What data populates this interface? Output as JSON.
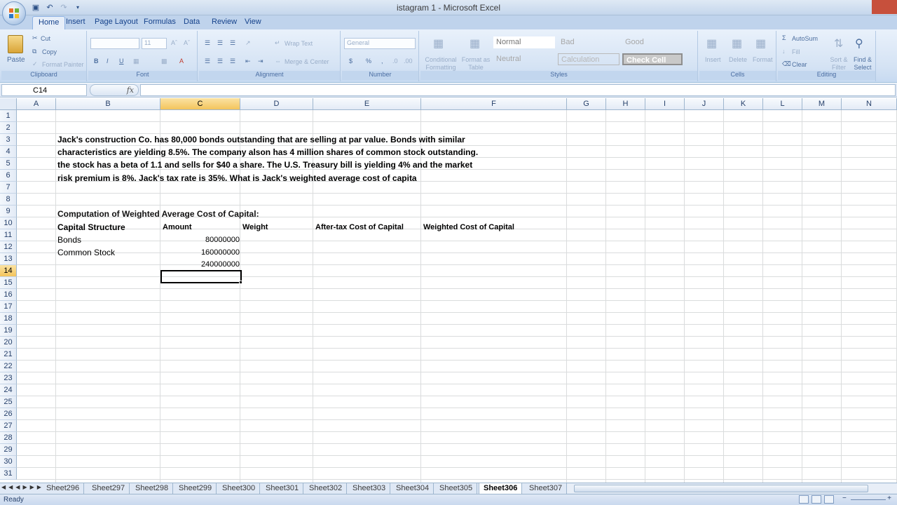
{
  "window": {
    "title": "istagram 1 - Microsoft Excel"
  },
  "ribbon_tabs": [
    "Home",
    "Insert",
    "Page Layout",
    "Formulas",
    "Data",
    "Review",
    "View"
  ],
  "clipboard": {
    "paste": "Paste",
    "cut": "Cut",
    "copy": "Copy",
    "format_painter": "Format Painter",
    "label": "Clipboard"
  },
  "font": {
    "name": "",
    "size": "11",
    "label": "Font"
  },
  "alignment": {
    "wrap": "Wrap Text",
    "merge": "Merge & Center",
    "label": "Alignment"
  },
  "number": {
    "format": "General",
    "label": "Number"
  },
  "styles": {
    "conditional": "Conditional Formatting",
    "format_table": "Format as Table",
    "normal": "Normal",
    "bad": "Bad",
    "good": "Good",
    "neutral": "Neutral",
    "calculation": "Calculation",
    "check_cell": "Check Cell",
    "label": "Styles"
  },
  "cells_group": {
    "insert": "Insert",
    "delete": "Delete",
    "format": "Format",
    "label": "Cells"
  },
  "editing": {
    "autosum": "AutoSum",
    "fill": "Fill",
    "clear": "Clear",
    "sort": "Sort & Filter",
    "find": "Find & Select",
    "label": "Editing"
  },
  "formula_bar": {
    "name_box": "C14",
    "fx": "fx",
    "formula": ""
  },
  "columns": [
    "A",
    "B",
    "C",
    "D",
    "E",
    "F",
    "G",
    "H",
    "I",
    "J",
    "K",
    "L",
    "M",
    "N"
  ],
  "rows": [
    "1",
    "2",
    "3",
    "4",
    "5",
    "6",
    "7",
    "8",
    "9",
    "10",
    "11",
    "12",
    "13",
    "14",
    "15",
    "16",
    "17",
    "18",
    "19",
    "20",
    "21",
    "22",
    "23",
    "24",
    "25",
    "26",
    "27",
    "28",
    "29",
    "30",
    "31"
  ],
  "sheet": {
    "problem_line1": "Jack's construction Co. has 80,000 bonds outstanding that are selling at par value. Bonds with similar",
    "problem_line2": "characteristics are yielding 8.5%. The company alson has 4 million shares of common stock outstanding.",
    "problem_line3": "the stock has a beta of 1.1 and sells for $40 a share. The U.S. Treasury bill is yielding 4% and the market",
    "problem_line4": " risk premium is 8%. Jack's tax rate is 35%. What is Jack's weighted average cost of capita",
    "heading": "Computation of Weighted Average Cost of Capital:",
    "headers": {
      "structure": "Capital Structure",
      "amount": "Amount",
      "weight": "Weight",
      "after_tax": "After-tax Cost of Capital",
      "weighted": "Weighted Cost of Capital"
    },
    "bonds_label": "Bonds",
    "bonds_amount": "80000000",
    "stock_label": "Common Stock",
    "stock_amount": "160000000",
    "total_amount": "240000000"
  },
  "sheet_tabs": [
    "Sheet296",
    "Sheet297",
    "Sheet298",
    "Sheet299",
    "Sheet300",
    "Sheet301",
    "Sheet302",
    "Sheet303",
    "Sheet304",
    "Sheet305",
    "Sheet306",
    "Sheet307"
  ],
  "active_sheet": "Sheet306",
  "status": {
    "ready": "Ready"
  }
}
